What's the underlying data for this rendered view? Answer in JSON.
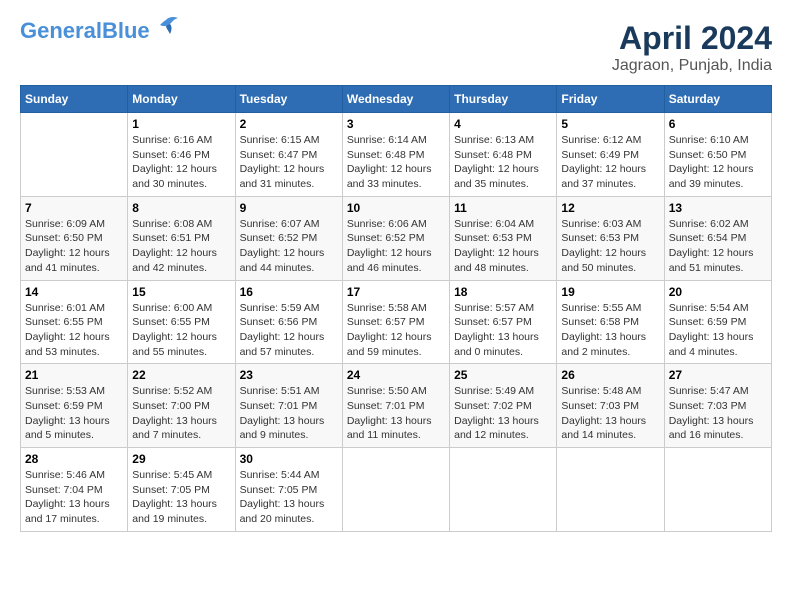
{
  "header": {
    "logo_line1": "General",
    "logo_line2": "Blue",
    "title": "April 2024",
    "subtitle": "Jagraon, Punjab, India"
  },
  "calendar": {
    "weekdays": [
      "Sunday",
      "Monday",
      "Tuesday",
      "Wednesday",
      "Thursday",
      "Friday",
      "Saturday"
    ],
    "weeks": [
      [
        {
          "day": "",
          "info": ""
        },
        {
          "day": "1",
          "info": "Sunrise: 6:16 AM\nSunset: 6:46 PM\nDaylight: 12 hours\nand 30 minutes."
        },
        {
          "day": "2",
          "info": "Sunrise: 6:15 AM\nSunset: 6:47 PM\nDaylight: 12 hours\nand 31 minutes."
        },
        {
          "day": "3",
          "info": "Sunrise: 6:14 AM\nSunset: 6:48 PM\nDaylight: 12 hours\nand 33 minutes."
        },
        {
          "day": "4",
          "info": "Sunrise: 6:13 AM\nSunset: 6:48 PM\nDaylight: 12 hours\nand 35 minutes."
        },
        {
          "day": "5",
          "info": "Sunrise: 6:12 AM\nSunset: 6:49 PM\nDaylight: 12 hours\nand 37 minutes."
        },
        {
          "day": "6",
          "info": "Sunrise: 6:10 AM\nSunset: 6:50 PM\nDaylight: 12 hours\nand 39 minutes."
        }
      ],
      [
        {
          "day": "7",
          "info": "Sunrise: 6:09 AM\nSunset: 6:50 PM\nDaylight: 12 hours\nand 41 minutes."
        },
        {
          "day": "8",
          "info": "Sunrise: 6:08 AM\nSunset: 6:51 PM\nDaylight: 12 hours\nand 42 minutes."
        },
        {
          "day": "9",
          "info": "Sunrise: 6:07 AM\nSunset: 6:52 PM\nDaylight: 12 hours\nand 44 minutes."
        },
        {
          "day": "10",
          "info": "Sunrise: 6:06 AM\nSunset: 6:52 PM\nDaylight: 12 hours\nand 46 minutes."
        },
        {
          "day": "11",
          "info": "Sunrise: 6:04 AM\nSunset: 6:53 PM\nDaylight: 12 hours\nand 48 minutes."
        },
        {
          "day": "12",
          "info": "Sunrise: 6:03 AM\nSunset: 6:53 PM\nDaylight: 12 hours\nand 50 minutes."
        },
        {
          "day": "13",
          "info": "Sunrise: 6:02 AM\nSunset: 6:54 PM\nDaylight: 12 hours\nand 51 minutes."
        }
      ],
      [
        {
          "day": "14",
          "info": "Sunrise: 6:01 AM\nSunset: 6:55 PM\nDaylight: 12 hours\nand 53 minutes."
        },
        {
          "day": "15",
          "info": "Sunrise: 6:00 AM\nSunset: 6:55 PM\nDaylight: 12 hours\nand 55 minutes."
        },
        {
          "day": "16",
          "info": "Sunrise: 5:59 AM\nSunset: 6:56 PM\nDaylight: 12 hours\nand 57 minutes."
        },
        {
          "day": "17",
          "info": "Sunrise: 5:58 AM\nSunset: 6:57 PM\nDaylight: 12 hours\nand 59 minutes."
        },
        {
          "day": "18",
          "info": "Sunrise: 5:57 AM\nSunset: 6:57 PM\nDaylight: 13 hours\nand 0 minutes."
        },
        {
          "day": "19",
          "info": "Sunrise: 5:55 AM\nSunset: 6:58 PM\nDaylight: 13 hours\nand 2 minutes."
        },
        {
          "day": "20",
          "info": "Sunrise: 5:54 AM\nSunset: 6:59 PM\nDaylight: 13 hours\nand 4 minutes."
        }
      ],
      [
        {
          "day": "21",
          "info": "Sunrise: 5:53 AM\nSunset: 6:59 PM\nDaylight: 13 hours\nand 5 minutes."
        },
        {
          "day": "22",
          "info": "Sunrise: 5:52 AM\nSunset: 7:00 PM\nDaylight: 13 hours\nand 7 minutes."
        },
        {
          "day": "23",
          "info": "Sunrise: 5:51 AM\nSunset: 7:01 PM\nDaylight: 13 hours\nand 9 minutes."
        },
        {
          "day": "24",
          "info": "Sunrise: 5:50 AM\nSunset: 7:01 PM\nDaylight: 13 hours\nand 11 minutes."
        },
        {
          "day": "25",
          "info": "Sunrise: 5:49 AM\nSunset: 7:02 PM\nDaylight: 13 hours\nand 12 minutes."
        },
        {
          "day": "26",
          "info": "Sunrise: 5:48 AM\nSunset: 7:03 PM\nDaylight: 13 hours\nand 14 minutes."
        },
        {
          "day": "27",
          "info": "Sunrise: 5:47 AM\nSunset: 7:03 PM\nDaylight: 13 hours\nand 16 minutes."
        }
      ],
      [
        {
          "day": "28",
          "info": "Sunrise: 5:46 AM\nSunset: 7:04 PM\nDaylight: 13 hours\nand 17 minutes."
        },
        {
          "day": "29",
          "info": "Sunrise: 5:45 AM\nSunset: 7:05 PM\nDaylight: 13 hours\nand 19 minutes."
        },
        {
          "day": "30",
          "info": "Sunrise: 5:44 AM\nSunset: 7:05 PM\nDaylight: 13 hours\nand 20 minutes."
        },
        {
          "day": "",
          "info": ""
        },
        {
          "day": "",
          "info": ""
        },
        {
          "day": "",
          "info": ""
        },
        {
          "day": "",
          "info": ""
        }
      ]
    ]
  }
}
